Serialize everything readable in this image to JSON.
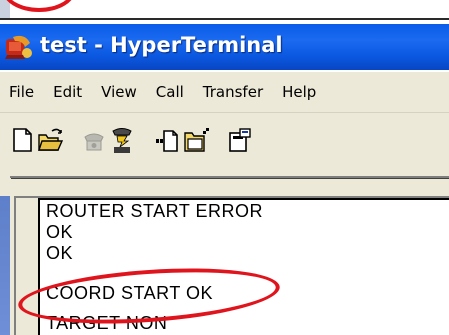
{
  "window": {
    "title": "test - HyperTerminal"
  },
  "menu": {
    "items": [
      "File",
      "Edit",
      "View",
      "Call",
      "Transfer",
      "Help"
    ]
  },
  "toolbar": {
    "buttons": [
      {
        "icon": "new-document-icon"
      },
      {
        "icon": "open-folder-icon"
      },
      {
        "icon": "call-phone-icon",
        "disabled": true
      },
      {
        "icon": "disconnect-phone-icon"
      },
      {
        "icon": "send-file-icon"
      },
      {
        "icon": "receive-file-icon"
      },
      {
        "icon": "properties-icon"
      }
    ]
  },
  "terminal": {
    "lines": [
      "ROUTER START ERROR",
      "OK",
      "OK",
      "COORD START OK",
      "TARGET NON"
    ]
  },
  "colors": {
    "titlebar": "#0a5ce8",
    "highlight": "#e0141c",
    "chrome": "#ece9d8"
  }
}
